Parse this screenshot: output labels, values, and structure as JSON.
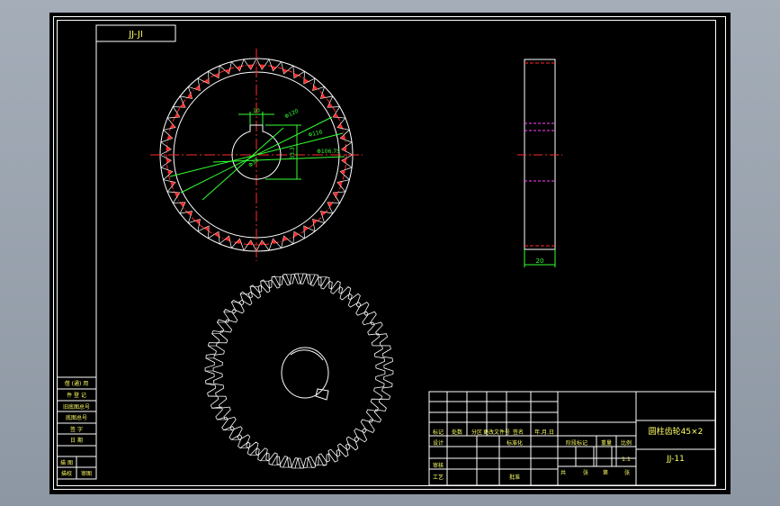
{
  "drawing": {
    "code_box": "JJ-JI",
    "dims": {
      "keyway_width": "10",
      "hub_height": "33.3",
      "pitch_dia": "Φ120",
      "tip_dia": "Φ116",
      "root_dia": "Φ106.75",
      "bore_dia": "Φ33",
      "face_width": "20"
    }
  },
  "left_strip": {
    "rows": [
      "借 (通) 用",
      "件 登 记",
      "旧底图总号",
      "底图总号",
      "签 字",
      "日 期",
      "",
      "描 图",
      "描校",
      "审图"
    ]
  },
  "title_block": {
    "part_name": "圆柱齿轮45×2",
    "drawing_no": "JJ-11",
    "row_labels_top": [
      "标记",
      "处数",
      "分区",
      "更改文件号",
      "签名",
      "年.月.日"
    ],
    "design": "设计",
    "standardize": "标准化",
    "review": "审核",
    "process": "工艺",
    "approve": "批准",
    "stage_mark": "阶段标记",
    "weight": "重量",
    "ratio": "比例",
    "scale": "1:1",
    "sheets_total": "共",
    "sheets_word": "张",
    "sheet_no": "第",
    "sheet_word": "张"
  },
  "colors": {
    "line": "#ffffff",
    "center": "#ff2a2a",
    "dim": "#33ff33",
    "hidden": "#ff44ff",
    "text": "#ffff66"
  }
}
